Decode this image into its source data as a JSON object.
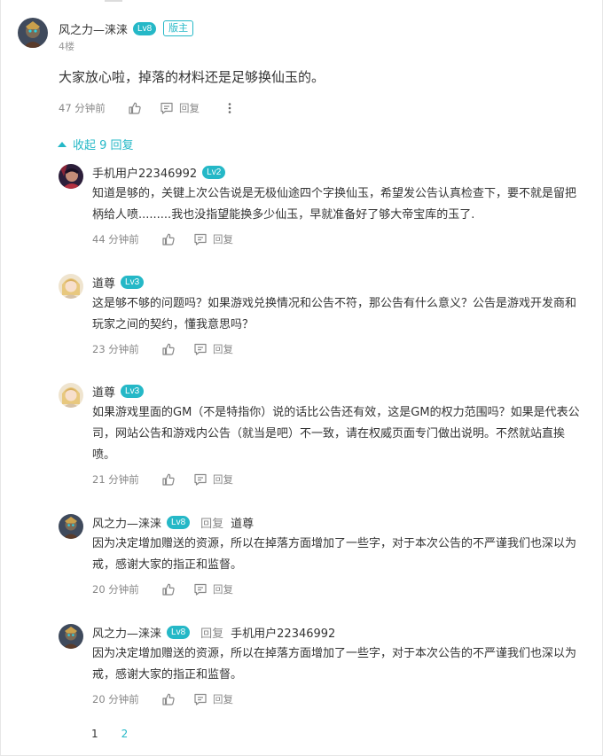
{
  "main_comment": {
    "username": "风之力—涞涞",
    "level": "Lv8",
    "role_badge": "版主",
    "floor": "4楼",
    "text": "大家放心啦，掉落的材料还是足够换仙玉的。",
    "time": "47 分钟前",
    "reply_label": "回复"
  },
  "collapse_label": "收起 9 回复",
  "replies": [
    {
      "username": "手机用户22346992",
      "level": "Lv2",
      "reply_to_label": "",
      "reply_to": "",
      "text": "知道是够的，关键上次公告说是无极仙途四个字换仙玉，希望发公告认真检查下，要不就是留把柄给人喷.........我也没指望能换多少仙玉，早就准备好了够大帝宝库的玉了.",
      "time": "44 分钟前",
      "reply_label": "回复"
    },
    {
      "username": "道尊",
      "level": "Lv3",
      "reply_to_label": "",
      "reply_to": "",
      "text": "这是够不够的问题吗？如果游戏兑换情况和公告不符，那公告有什么意义？公告是游戏开发商和玩家之间的契约，懂我意思吗？",
      "time": "23 分钟前",
      "reply_label": "回复"
    },
    {
      "username": "道尊",
      "level": "Lv3",
      "reply_to_label": "",
      "reply_to": "",
      "text": "如果游戏里面的GM（不是特指你）说的话比公告还有效，这是GM的权力范围吗？如果是代表公司，网站公告和游戏内公告（就当是吧）不一致，请在权威页面专门做出说明。不然就站直挨喷。",
      "time": "21 分钟前",
      "reply_label": "回复"
    },
    {
      "username": "风之力—涞涞",
      "level": "Lv8",
      "reply_to_label": "回复",
      "reply_to": "道尊",
      "text": "因为决定增加赠送的资源，所以在掉落方面增加了一些字，对于本次公告的不严谨我们也深以为戒，感谢大家的指正和监督。",
      "time": "20 分钟前",
      "reply_label": "回复"
    },
    {
      "username": "风之力—涞涞",
      "level": "Lv8",
      "reply_to_label": "回复",
      "reply_to": "手机用户22346992",
      "text": "因为决定增加赠送的资源，所以在掉落方面增加了一些字，对于本次公告的不严谨我们也深以为戒，感谢大家的指正和监督。",
      "time": "20 分钟前",
      "reply_label": "回复"
    }
  ],
  "pagination": {
    "page_1": "1",
    "page_2": "2"
  },
  "colors": {
    "accent": "#25b8c7",
    "text": "#333333",
    "muted": "#888888"
  },
  "icons": {
    "like": "thumbs-up-icon",
    "reply": "comment-icon",
    "more": "more-vertical-icon",
    "collapse": "triangle-up-icon"
  }
}
